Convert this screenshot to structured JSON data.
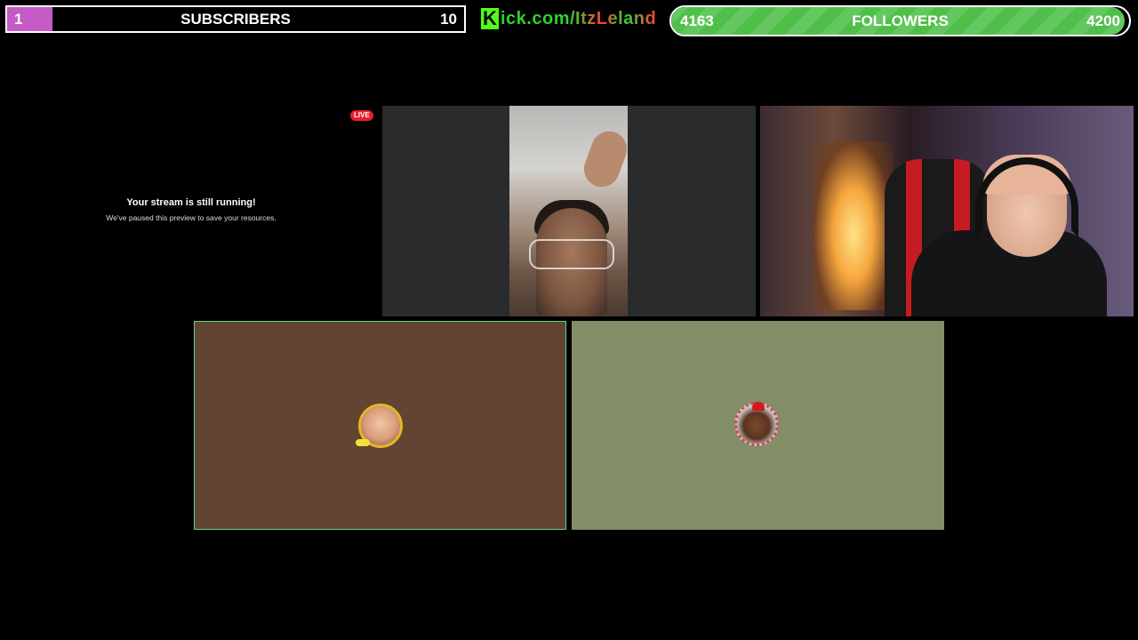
{
  "subscribers": {
    "current": "1",
    "label": "SUBSCRIBERS",
    "goal": "10",
    "progress_fraction": 0.1,
    "fill_color": "#c45bc6"
  },
  "kick": {
    "logo_letter": "K",
    "url_text": "ick.com/ItzLeland",
    "brand_color": "#53fc18"
  },
  "followers": {
    "current": "4163",
    "label": "FOLLOWERS",
    "goal": "4200",
    "progress_fraction": 0.991,
    "fill_color": "#4fbf4a"
  },
  "preview": {
    "live_badge": "LIVE",
    "title": "Your stream is still running!",
    "subtitle": "We've paused this preview to save your resources."
  },
  "tiles": {
    "left_avatar_bg": "#614532",
    "right_avatar_bg": "#838d68",
    "active_border": "#5fd38a"
  }
}
